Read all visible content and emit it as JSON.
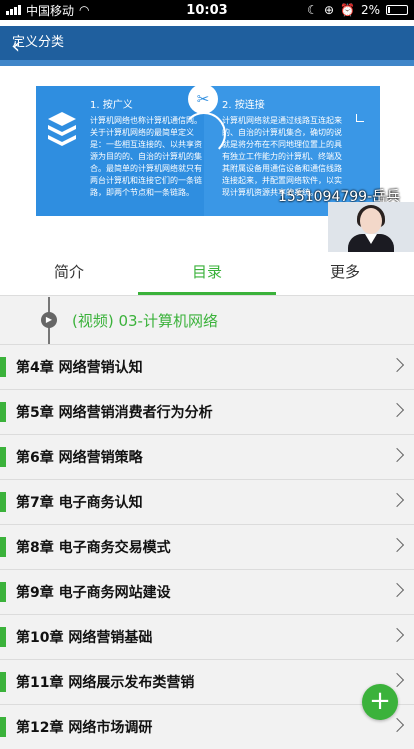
{
  "status_bar": {
    "carrier": "中国移动",
    "time": "10:03",
    "battery": "2%"
  },
  "video": {
    "slide_header": "定义分类",
    "col1_title": "1. 按广义",
    "col1_text": "计算机网络也称计算机通信网。关于计算机网络的最简单定义是：一些相互连接的、以共享资源为目的的、自治的计算机的集合。最简单的计算机网络就只有两台计算机和连接它们的一条链路，即两个节点和一条链路。",
    "col2_title": "2. 按连接",
    "col2_text": "计算机网络就是通过线路互连起来的、自治的计算机集合，确切的说就是将分布在不同地理位置上的具有独立工作能力的计算机、终端及其附属设备用通信设备和通信线路连接起来，并配置网络软件，以实现计算机资源共享的系统。",
    "teacher_caption": "15510947​99-岳兵"
  },
  "tabs": [
    {
      "label": "简介",
      "active": false
    },
    {
      "label": "目录",
      "active": true
    },
    {
      "label": "更多",
      "active": false
    }
  ],
  "current_video": "(视频) 03-计算机网络",
  "chapters": [
    {
      "title": "第4章  网络营销认知"
    },
    {
      "title": "第5章  网络营销消费者行为分析"
    },
    {
      "title": "第6章  网络营销策略"
    },
    {
      "title": "第7章  电子商务认知"
    },
    {
      "title": "第8章  电子商务交易模式"
    },
    {
      "title": "第9章  电子商务网站建设"
    },
    {
      "title": "第10章  网络营销基础"
    },
    {
      "title": "第11章  网络展示发布类营销"
    },
    {
      "title": "第12章  网络市场调研"
    }
  ],
  "colors": {
    "accent": "#3bb23b",
    "slide_blue": "#2f8ee0",
    "header_blue": "#1f5f9e"
  },
  "icons": {
    "back": "chevron-left-icon",
    "slide_left": "layers-icon",
    "slide_center": "tools-icon",
    "play": "play-icon",
    "row_arrow": "chevron-right-icon",
    "fab": "plus-icon"
  }
}
